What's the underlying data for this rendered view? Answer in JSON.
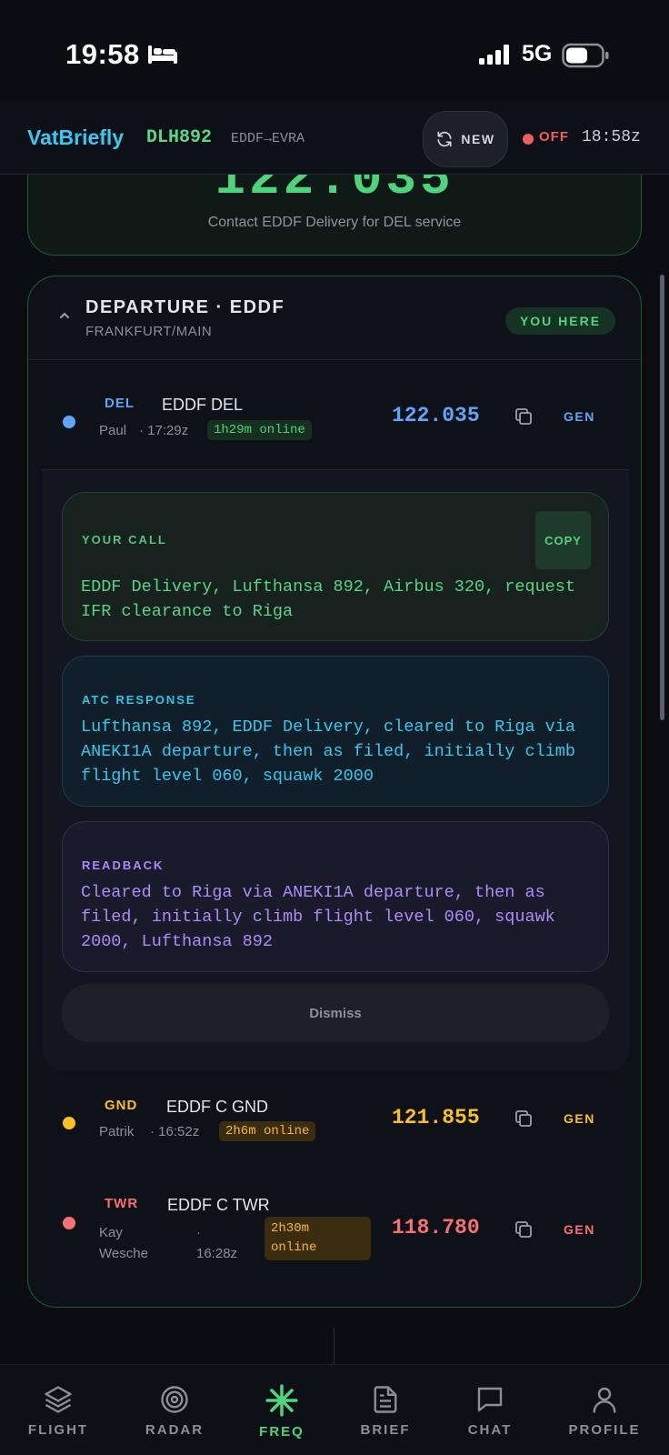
{
  "status_bar": {
    "time": "19:58",
    "network": "5G"
  },
  "header": {
    "logo": "VatBriefly",
    "callsign": "DLH892",
    "route": "EDDF→EVRA",
    "new_label": "NEW",
    "connection_status": "OFF",
    "zulu_time": "18:58z"
  },
  "top_card": {
    "frequency": "122.035",
    "note": "Contact EDDF Delivery for DEL service"
  },
  "departure": {
    "title": "DEPARTURE · EDDF",
    "subtitle": "FRANKFURT/MAIN",
    "badge": "YOU HERE",
    "stations": [
      {
        "type": "DEL",
        "name": "EDDF DEL",
        "person": "Paul",
        "time": "· 17:29z",
        "online": "1h29m online",
        "frequency": "122.035",
        "gen": "GEN",
        "color": "#60a5fa"
      },
      {
        "type": "GND",
        "name": "EDDF C GND",
        "person": "Patrik",
        "time": "· 16:52z",
        "online": "2h6m online",
        "frequency": "121.855",
        "gen": "GEN",
        "color": "#fbbf24"
      },
      {
        "type": "TWR",
        "name": "EDDF C TWR",
        "person_line1": "Kay",
        "person_line2": "Wesche",
        "time_line1": "·",
        "time_line2": "16:28z",
        "online_line1": "2h30m",
        "online_line2": "online",
        "frequency": "118.780",
        "gen": "GEN",
        "color": "#f87171"
      }
    ]
  },
  "del_panel": {
    "your_call": {
      "label": "YOUR CALL",
      "copy_label": "COPY",
      "line1": "EDDF Delivery, Lufthansa 892, Airbus 320, request",
      "line2": "IFR clearance to Riga"
    },
    "atc_response": {
      "label": "ATC RESPONSE",
      "line1": "Lufthansa 892, EDDF Delivery, cleared to Riga via",
      "line2": "ANEKI1A departure, then as filed, initially climb",
      "line3": "flight level 060, squawk 2000"
    },
    "readback": {
      "label": "READBACK",
      "line1": "Cleared to Riga via ANEKI1A departure, then as",
      "line2": "filed, initially climb flight level 060, squawk",
      "line3": "2000, Lufthansa 892"
    },
    "dismiss_label": "Dismiss"
  },
  "bottom_nav": {
    "items": [
      {
        "label": "FLIGHT",
        "icon": "layers-icon"
      },
      {
        "label": "RADAR",
        "icon": "radar-icon"
      },
      {
        "label": "FREQ",
        "icon": "asterisk-icon",
        "active": true
      },
      {
        "label": "BRIEF",
        "icon": "document-icon"
      },
      {
        "label": "CHAT",
        "icon": "chat-bubble-icon"
      },
      {
        "label": "PROFILE",
        "icon": "person-icon"
      }
    ]
  }
}
